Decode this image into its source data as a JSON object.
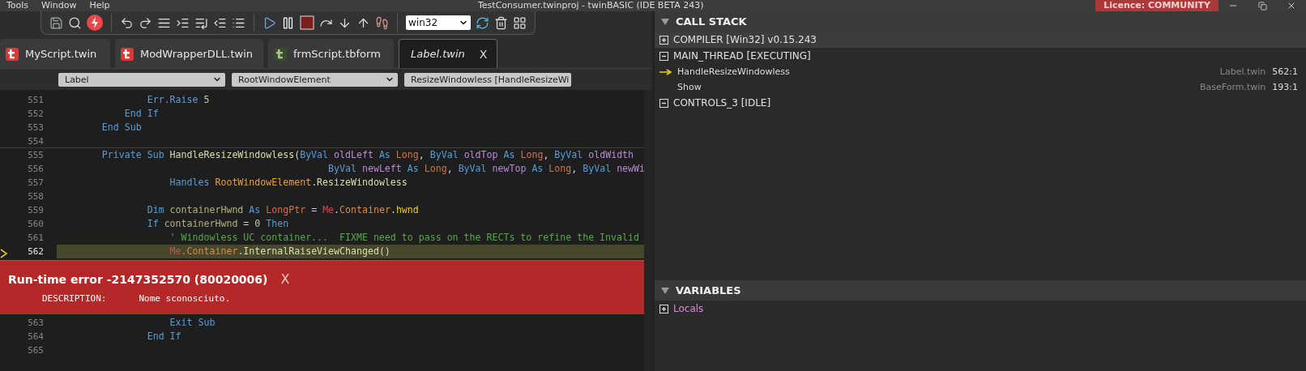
{
  "title_bar": {
    "menus": [
      "Tools",
      "Window",
      "Help"
    ],
    "title": "TestConsumer.twinproj - twinBASIC (IDE BETA 243)",
    "licence": "Licence: COMMUNITY"
  },
  "toolbar": {
    "target": "win32"
  },
  "tabs": [
    {
      "label": "MyScript.twin",
      "kind": "module",
      "selected": false
    },
    {
      "label": "ModWrapperDLL.twin",
      "kind": "module",
      "selected": false
    },
    {
      "label": "frmScript.tbform",
      "kind": "form",
      "selected": false
    },
    {
      "label": "Label.twin",
      "kind": "module",
      "selected": true,
      "close": "X"
    }
  ],
  "selectors": [
    "Label",
    "RootWindowElement",
    "ResizeWindowless [HandleResizeWi"
  ],
  "editor": {
    "lines": [
      {
        "number": "551",
        "current": false,
        "tokens": [
          {
            "kind": "kw",
            "t": "                Err.Raise"
          },
          {
            "kind": "num",
            "t": " 5"
          }
        ]
      },
      {
        "number": "552",
        "current": false,
        "tokens": [
          {
            "kind": "kw",
            "t": "            End If"
          }
        ]
      },
      {
        "number": "553",
        "current": false,
        "tokens": [
          {
            "kind": "kw",
            "t": "        End Sub"
          }
        ]
      },
      {
        "number": "554",
        "current": false,
        "divider_below": true
      },
      {
        "number": "555",
        "current": false,
        "tokens": [
          {
            "kind": "kw",
            "t": "        Private Sub "
          },
          {
            "kind": "func",
            "t": "HandleResizeWindowless"
          },
          {
            "kind": "plain",
            "t": "("
          },
          {
            "kind": "kw",
            "t": "ByVal "
          },
          {
            "kind": "param",
            "t": "oldLeft "
          },
          {
            "kind": "kw",
            "t": "As "
          },
          {
            "kind": "type",
            "t": "Long"
          },
          {
            "kind": "plain",
            "t": ", "
          },
          {
            "kind": "kw",
            "t": "ByVal "
          },
          {
            "kind": "param",
            "t": "oldTop "
          },
          {
            "kind": "kw",
            "t": "As "
          },
          {
            "kind": "type",
            "t": "Long"
          },
          {
            "kind": "plain",
            "t": ", "
          },
          {
            "kind": "kw",
            "t": "ByVal "
          },
          {
            "kind": "param",
            "t": "oldWidth"
          }
        ]
      },
      {
        "number": "556",
        "current": false,
        "tokens": [
          {
            "kind": "kw",
            "t": "                                                ByVal "
          },
          {
            "kind": "param",
            "t": "newLeft "
          },
          {
            "kind": "kw",
            "t": "As "
          },
          {
            "kind": "type",
            "t": "Long"
          },
          {
            "kind": "plain",
            "t": ", "
          },
          {
            "kind": "kw",
            "t": "ByVal "
          },
          {
            "kind": "param",
            "t": "newTop "
          },
          {
            "kind": "kw",
            "t": "As "
          },
          {
            "kind": "type",
            "t": "Long"
          },
          {
            "kind": "plain",
            "t": ", "
          },
          {
            "kind": "kw",
            "t": "ByVal "
          },
          {
            "kind": "param",
            "t": "newWi"
          }
        ]
      },
      {
        "number": "557",
        "current": false,
        "tokens": [
          {
            "kind": "kw",
            "t": "                    Handles "
          },
          {
            "kind": "event",
            "t": "RootWindowElement"
          },
          {
            "kind": "plain",
            "t": "."
          },
          {
            "kind": "func",
            "t": "ResizeWindowless"
          }
        ]
      },
      {
        "number": "558",
        "current": false
      },
      {
        "number": "559",
        "current": false,
        "tokens": [
          {
            "kind": "kw",
            "t": "                Dim "
          },
          {
            "kind": "var",
            "t": "containerHwnd "
          },
          {
            "kind": "kw",
            "t": "As "
          },
          {
            "kind": "type",
            "t": "LongPtr"
          },
          {
            "kind": "plain",
            "t": " = "
          },
          {
            "kind": "me",
            "t": "Me"
          },
          {
            "kind": "plain",
            "t": "."
          },
          {
            "kind": "member",
            "t": "Container"
          },
          {
            "kind": "plain",
            "t": "."
          },
          {
            "kind": "prop",
            "t": "hwnd"
          }
        ]
      },
      {
        "number": "560",
        "current": false,
        "tokens": [
          {
            "kind": "kw",
            "t": "                If "
          },
          {
            "kind": "var",
            "t": "containerHwnd"
          },
          {
            "kind": "plain",
            "t": " = "
          },
          {
            "kind": "num",
            "t": "0"
          },
          {
            "kind": "kw",
            "t": " Then"
          }
        ]
      },
      {
        "number": "561",
        "current": false,
        "tokens": [
          {
            "kind": "comment",
            "t": "                    ' Windowless UC container...  FIXME need to pass on the RECTs to refine the Invalid"
          }
        ]
      },
      {
        "number": "562",
        "current": true,
        "tokens": [
          {
            "kind": "me",
            "t": "                    Me"
          },
          {
            "kind": "member",
            "t": ".Container"
          },
          {
            "kind": "func",
            "t": ".InternalRaiseViewChanged()"
          }
        ]
      }
    ],
    "error": {
      "title": "Run-time error -2147352570 (80020006)",
      "close": "X",
      "label": "DESCRIPTION:",
      "message": "Nome sconosciuto."
    },
    "lines_below": [
      {
        "number": "563",
        "current": false,
        "tokens": [
          {
            "kind": "kw",
            "t": "                    Exit Sub"
          }
        ]
      },
      {
        "number": "564",
        "current": false,
        "tokens": [
          {
            "kind": "kw",
            "t": "                End If"
          }
        ]
      },
      {
        "number": "565",
        "current": false
      }
    ]
  },
  "call_stack": {
    "title": "CALL STACK",
    "expanded": true,
    "threads": [
      {
        "label": "COMPILER [Win32] v0.15.243",
        "expanded": false,
        "selected": true
      },
      {
        "label": "MAIN_THREAD [EXECUTING]",
        "expanded": true,
        "selected": false,
        "frames": [
          {
            "name": "HandleResizeWindowless",
            "file": "Label.twin",
            "location": "562:1",
            "current": true
          },
          {
            "name": "Show",
            "file": "BaseForm.twin",
            "location": "193:1",
            "current": false
          }
        ]
      },
      {
        "label": "CONTROLS_3 [IDLE]",
        "expanded": true,
        "selected": false
      }
    ]
  },
  "variables": {
    "title": "VARIABLES",
    "expanded": true,
    "items": [
      {
        "label": "Locals",
        "expanded": false
      }
    ]
  }
}
